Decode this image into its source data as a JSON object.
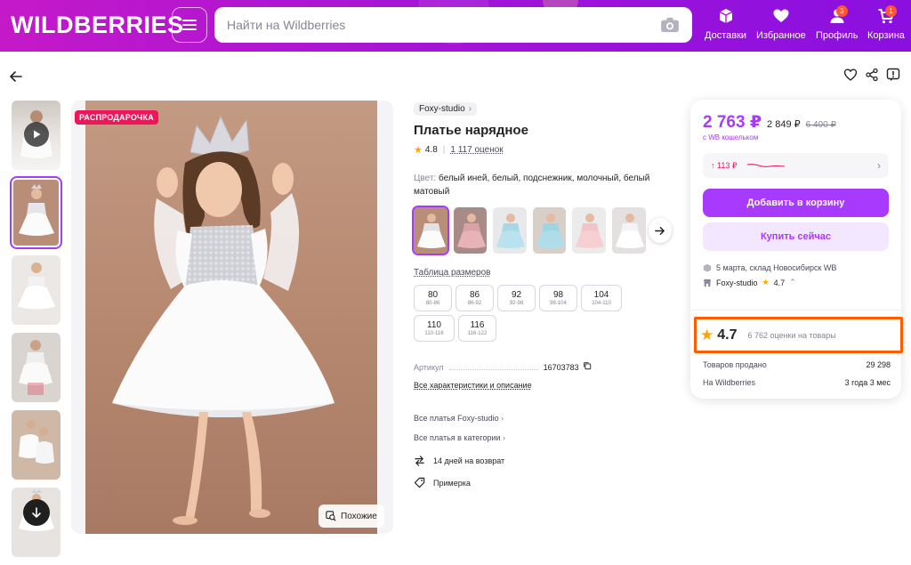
{
  "header": {
    "logo": "WILDBERRIES",
    "search_placeholder": "Найти на Wildberries",
    "nav": [
      {
        "label": "Доставки",
        "icon": "box-icon",
        "badge": ""
      },
      {
        "label": "Избранное",
        "icon": "heart-icon",
        "badge": ""
      },
      {
        "label": "Профиль",
        "icon": "user-icon",
        "badge": "3"
      },
      {
        "label": "Корзина",
        "icon": "cart-icon",
        "badge": "1"
      }
    ]
  },
  "gallery": {
    "sale_badge": "РАСПРОДАРОЧКА",
    "similar_label": "Похожие"
  },
  "product": {
    "brand": "Foxy-studio",
    "title": "Платье нарядное",
    "rating": "4.8",
    "reviews": "1 117 оценок",
    "color_label": "Цвет:",
    "color_value": "белый иней, белый, подснежник, молочный, белый матовый",
    "size_table_link": "Таблица размеров",
    "sizes": [
      {
        "size": "80",
        "range": "80-86"
      },
      {
        "size": "86",
        "range": "86-92"
      },
      {
        "size": "92",
        "range": "92-98"
      },
      {
        "size": "98",
        "range": "98-104"
      },
      {
        "size": "104",
        "range": "104-110"
      },
      {
        "size": "110",
        "range": "110-116"
      },
      {
        "size": "116",
        "range": "116-122"
      }
    ],
    "article_label": "Артикул",
    "article_value": "16703783",
    "all_chars_link": "Все характеристики и описание",
    "links": [
      "Все платья Foxy-studio",
      "Все платья в категории"
    ],
    "features": [
      "14 дней на возврат",
      "Примерка"
    ]
  },
  "price_card": {
    "price": "2 763 ₽",
    "price_mid": "2 849 ₽",
    "price_old": "6 400 ₽",
    "wallet_note": "с WB кошельком",
    "history": "↑ 113 ₽",
    "add_to_cart": "Добавить в корзину",
    "buy_now": "Купить сейчас",
    "delivery": "5 марта, склад Новосибирск WB",
    "seller": "Foxy-studio",
    "seller_rating": "4.7",
    "store_rating": "4.7",
    "store_reviews": "6 762 оценки на товары",
    "sold_label": "Товаров продано",
    "sold_value": "29 298",
    "on_wb_label": "На Wildberries",
    "on_wb_value": "3 года 3 мес"
  },
  "colors": {
    "accent": "#a73afd",
    "sale": "#f0145a",
    "highlight": "#ff5c00",
    "star": "#ffa500"
  }
}
